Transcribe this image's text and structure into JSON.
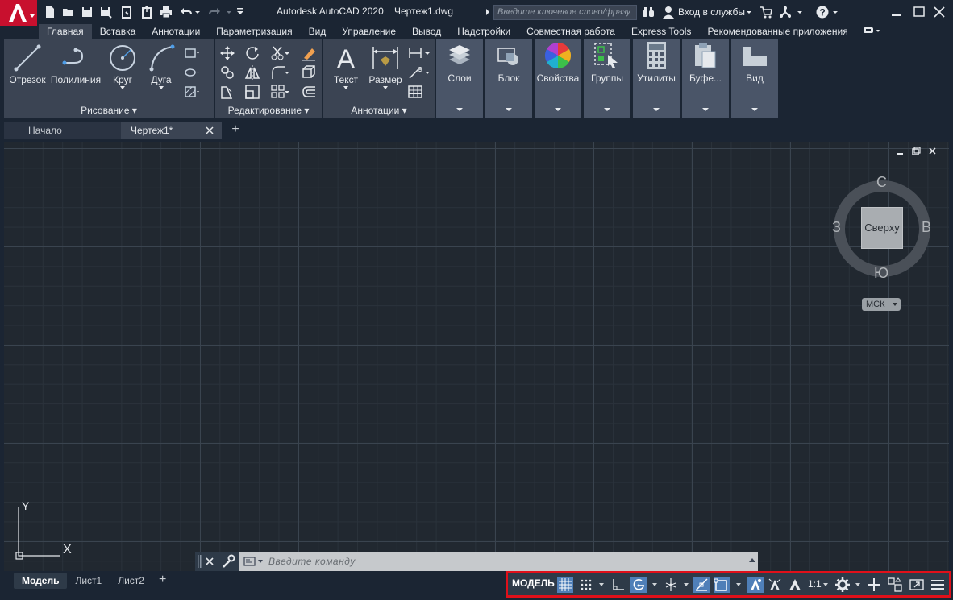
{
  "title": {
    "app": "Autodesk AutoCAD 2020",
    "file": "Чертеж1.dwg"
  },
  "search": {
    "placeholder": "Введите ключевое слово/фразу"
  },
  "account": {
    "login": "Вход в службы"
  },
  "ribbon_tabs": [
    "Главная",
    "Вставка",
    "Аннотации",
    "Параметризация",
    "Вид",
    "Управление",
    "Вывод",
    "Надстройки",
    "Совместная работа",
    "Express Tools",
    "Рекомендованные приложения"
  ],
  "draw_panel": {
    "title": "Рисование",
    "line": "Отрезок",
    "polyline": "Полилиния",
    "circle": "Круг",
    "arc": "Дуга"
  },
  "modify_panel": {
    "title": "Редактирование"
  },
  "annot_panel": {
    "title": "Аннотации",
    "text": "Текст",
    "dimension": "Размер"
  },
  "big_panels": [
    "Слои",
    "Блок",
    "Свойства",
    "Группы",
    "Утилиты",
    "Буфе...",
    "Вид"
  ],
  "file_tabs": {
    "start": "Начало",
    "drawing": "Чертеж1*"
  },
  "viewcube": {
    "top": "Сверху",
    "north": "С",
    "south": "Ю",
    "west": "З",
    "east": "В",
    "wcs": "МСК"
  },
  "ucs": {
    "x": "X",
    "y": "Y"
  },
  "command": {
    "placeholder": "Введите команду"
  },
  "layout_tabs": [
    "Модель",
    "Лист1",
    "Лист2"
  ],
  "status": {
    "model": "МОДЕЛЬ",
    "scale": "1:1"
  },
  "colors": {
    "accent": "#4f7fb8",
    "highlight": "#e0101a",
    "logo": "#c8102e"
  }
}
